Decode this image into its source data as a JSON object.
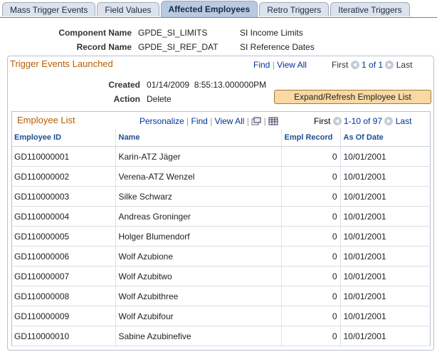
{
  "tabs": [
    {
      "label": "Mass Trigger Events"
    },
    {
      "label": "Field Values"
    },
    {
      "label": "Affected Employees"
    },
    {
      "label": "Retro Triggers"
    },
    {
      "label": "Iterative Triggers"
    }
  ],
  "header": {
    "component_label": "Component Name",
    "component_value": "GPDE_SI_LIMITS",
    "component_desc": "SI Income Limits",
    "record_label": "Record Name",
    "record_value": "GPDE_SI_REF_DAT",
    "record_desc": "SI Reference Dates"
  },
  "trigger_events": {
    "title": "Trigger Events Launched",
    "find": "Find",
    "view_all": "View All",
    "first": "First",
    "pager": "1 of 1",
    "last": "Last",
    "created_label": "Created",
    "created_value": "01/14/2009  8:55:13.000000PM",
    "action_label": "Action",
    "action_value": "Delete",
    "expand_button": "Expand/Refresh Employee List"
  },
  "employee_list": {
    "title": "Employee List",
    "personalize": "Personalize",
    "find": "Find",
    "view_all": "View All",
    "first": "First",
    "pager": "1-10 of 97",
    "last": "Last",
    "columns": [
      "Employee ID",
      "Name",
      "Empl Record",
      "As Of Date"
    ],
    "rows": [
      [
        "GD110000001",
        "Karin-ATZ Jäger",
        "0",
        "10/01/2001"
      ],
      [
        "GD110000002",
        "Verena-ATZ Wenzel",
        "0",
        "10/01/2001"
      ],
      [
        "GD110000003",
        "Silke Schwarz",
        "0",
        "10/01/2001"
      ],
      [
        "GD110000004",
        "Andreas Groninger",
        "0",
        "10/01/2001"
      ],
      [
        "GD110000005",
        "Holger Blumendorf",
        "0",
        "10/01/2001"
      ],
      [
        "GD110000006",
        "Wolf Azubione",
        "0",
        "10/01/2001"
      ],
      [
        "GD110000007",
        "Wolf Azubitwo",
        "0",
        "10/01/2001"
      ],
      [
        "GD110000008",
        "Wolf Azubithree",
        "0",
        "10/01/2001"
      ],
      [
        "GD110000009",
        "Wolf Azubifour",
        "0",
        "10/01/2001"
      ],
      [
        "GD110000010",
        "Sabine Azubinefive",
        "0",
        "10/01/2001"
      ]
    ]
  }
}
